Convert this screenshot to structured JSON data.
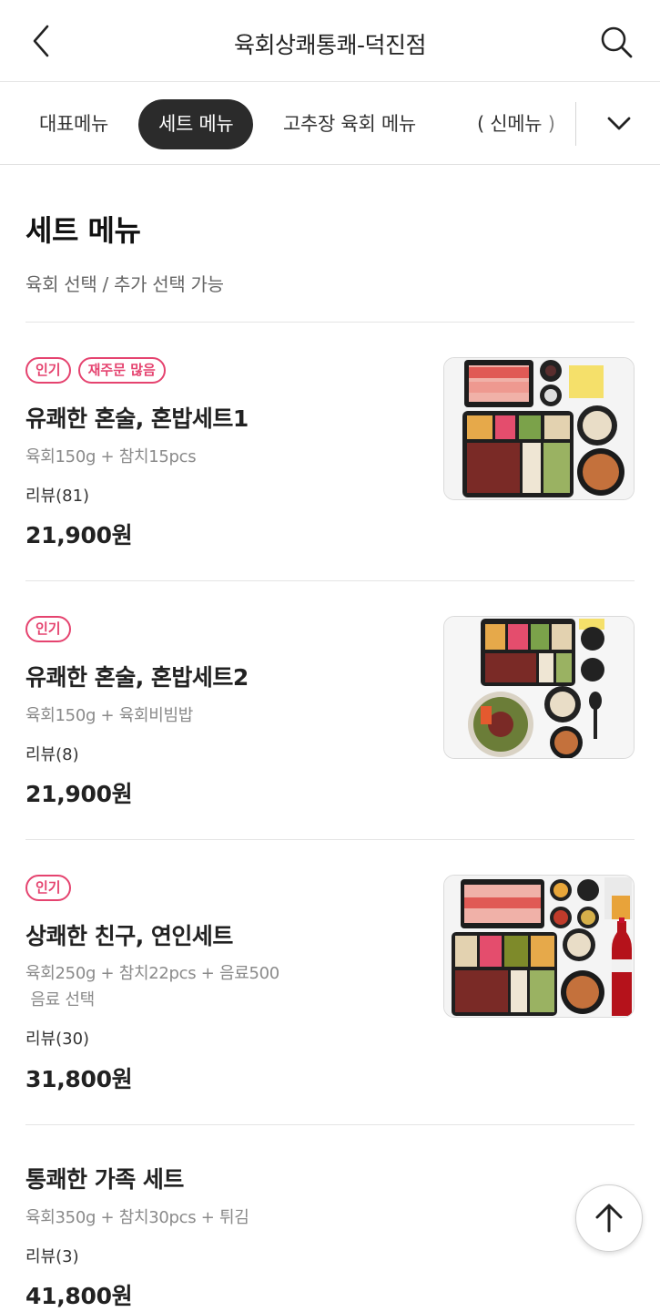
{
  "header": {
    "title": "육회상쾌통쾌-덕진점",
    "back_icon": "back-icon",
    "search_icon": "search-icon"
  },
  "tabs": [
    {
      "label": "대표메뉴"
    },
    {
      "label": "세트 메뉴",
      "active": true
    },
    {
      "label": "고추장 육회 메뉴"
    },
    {
      "label": "( 신메뉴 )"
    }
  ],
  "section": {
    "title": "세트 메뉴",
    "description": "육회 선택 / 추가 선택 가능"
  },
  "items": [
    {
      "badges": [
        "인기",
        "재주문 많음"
      ],
      "name": "유쾌한 혼술, 혼밥세트1",
      "desc": "육회150g + 참치15pcs",
      "review": "리뷰(81)",
      "price": "21,900원"
    },
    {
      "badges": [
        "인기"
      ],
      "name": "유쾌한 혼술, 혼밥세트2",
      "desc": "육회150g + 육회비빔밥",
      "review": "리뷰(8)",
      "price": "21,900원"
    },
    {
      "badges": [
        "인기"
      ],
      "name": "상쾌한 친구, 연인세트",
      "desc": "육회250g + 참치22pcs + 음료500\n 음료 선택",
      "review": "리뷰(30)",
      "price": "31,800원"
    },
    {
      "badges": [],
      "name": "통쾌한 가족 세트",
      "desc": "육회350g + 참치30pcs + 튀김",
      "review": "리뷰(3)",
      "price": "41,800원"
    }
  ],
  "colors": {
    "badge": "#e5436f",
    "active_tab_bg": "#2b2b2b",
    "text": "#222222",
    "muted": "#8a8a8a"
  },
  "scroll_top_icon": "arrow-up-icon"
}
